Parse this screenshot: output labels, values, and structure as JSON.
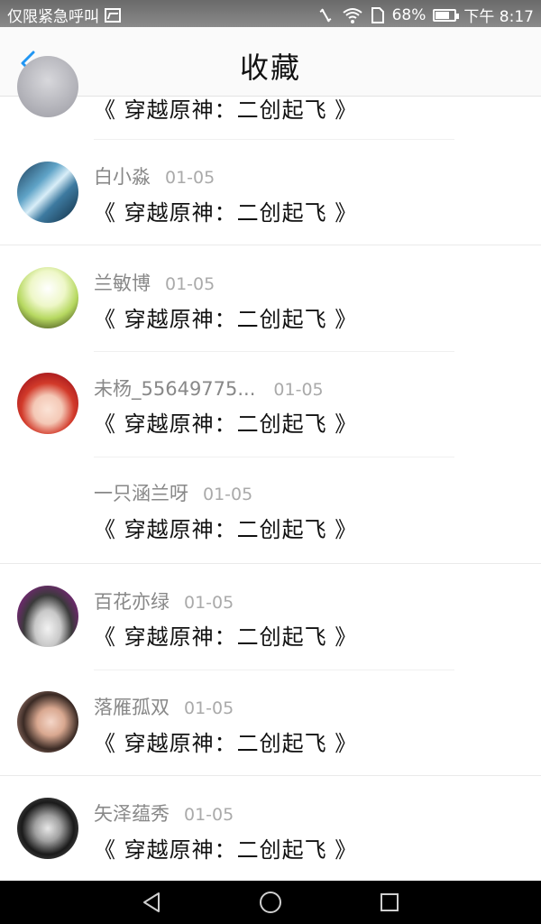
{
  "status_bar": {
    "carrier": "仅限紧急呼叫",
    "battery": "68%",
    "time": "下午 8:17"
  },
  "header": {
    "title": "收藏",
    "back_icon": "chevron-left-icon"
  },
  "items": [
    {
      "user": "",
      "date": "",
      "work": "《 穿越原神：二创起飞 》"
    },
    {
      "user": "白小淼",
      "date": "01-05",
      "work": "《 穿越原神：二创起飞 》"
    },
    {
      "user": "兰敏博",
      "date": "01-05",
      "work": "《 穿越原神：二创起飞 》"
    },
    {
      "user": "未杨_55649775...",
      "date": "01-05",
      "work": "《 穿越原神：二创起飞 》"
    },
    {
      "user": "一只涵兰呀",
      "date": "01-05",
      "work": "《 穿越原神：二创起飞 》"
    },
    {
      "user": "百花亦绿",
      "date": "01-05",
      "work": "《 穿越原神：二创起飞 》"
    },
    {
      "user": "落雁孤双",
      "date": "01-05",
      "work": "《 穿越原神：二创起飞 》"
    },
    {
      "user": "矢泽蕴秀",
      "date": "01-05",
      "work": "《 穿越原神：二创起飞 》"
    }
  ],
  "colors": {
    "accent": "#2196f3",
    "username": "#888888",
    "date": "#aaaaaa",
    "title": "#111111"
  }
}
